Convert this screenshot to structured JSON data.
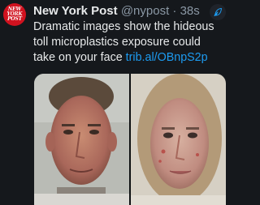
{
  "author": {
    "avatar_text": [
      "NEW",
      "YORK",
      "POST"
    ],
    "display_name": "New York Post",
    "handle": "@nypost",
    "separator": "·",
    "time": "38s"
  },
  "tweet": {
    "text": "Dramatic images show the hideous toll microplastics exposure could take on your face ",
    "link": "trib.al/OBnpS2p"
  },
  "icons": {
    "action": "feather-compose-icon"
  },
  "colors": {
    "background": "#15181c",
    "avatar": "#d1121f",
    "link": "#1d9bf0",
    "secondary_text": "#8b98a5"
  }
}
